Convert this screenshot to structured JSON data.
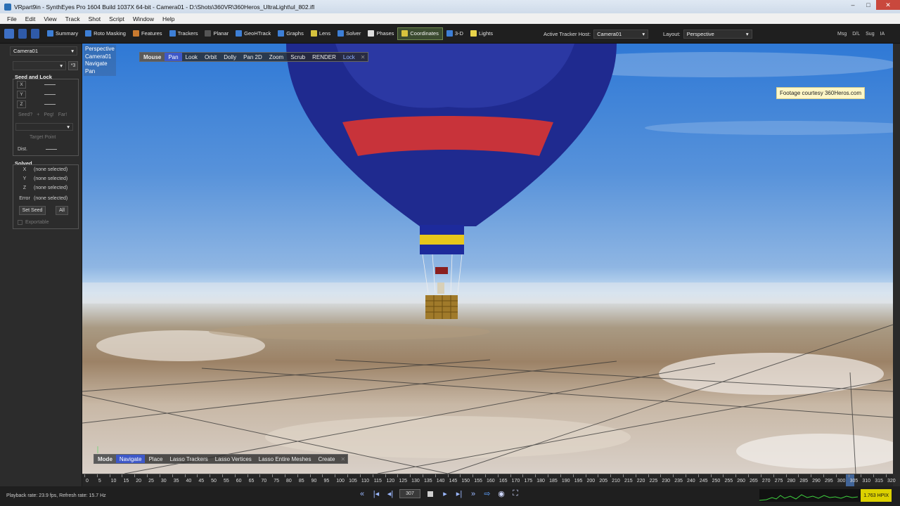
{
  "window": {
    "title": "VRpart9in - SynthEyes Pro 1604 Build 1037X 64-bit - Camera01 - D:\\Shots\\360VR\\360Heros_UltraLight\\ul_802.ifl",
    "controls": [
      "–",
      "□",
      "✕"
    ]
  },
  "menu": [
    "File",
    "Edit",
    "View",
    "Track",
    "Shot",
    "Script",
    "Window",
    "Help"
  ],
  "toolbar": {
    "buttons": [
      {
        "label": "Summary",
        "icon": "summary-icon",
        "color": "#3d7fd6"
      },
      {
        "label": "Roto Masking",
        "icon": "roto-icon",
        "color": "#3d7fd6"
      },
      {
        "label": "Features",
        "icon": "features-icon",
        "color": "#c97a2f"
      },
      {
        "label": "Trackers",
        "icon": "trackers-icon",
        "color": "#3d7fd6"
      },
      {
        "label": "Planar",
        "icon": "planar-icon",
        "color": "#555555"
      },
      {
        "label": "GeoHTrack",
        "icon": "geoh-icon",
        "color": "#3d7fd6"
      },
      {
        "label": "Graphs",
        "icon": "graphs-icon",
        "color": "#3d7fd6"
      },
      {
        "label": "Lens",
        "icon": "lens-icon",
        "color": "#d6c23d"
      },
      {
        "label": "Solver",
        "icon": "solver-icon",
        "color": "#3d7fd6"
      },
      {
        "label": "Phases",
        "icon": "phases-icon",
        "color": "#dddddd"
      },
      {
        "label": "Coordinates",
        "icon": "coordinates-icon",
        "color": "#d6c23d",
        "active": true
      },
      {
        "label": "3-D",
        "icon": "3d-icon",
        "color": "#3d7fd6"
      },
      {
        "label": "Lights",
        "icon": "lights-icon",
        "color": "#e8d34a"
      }
    ],
    "active_tracker_host_label": "Active Tracker Host:",
    "active_tracker_host_value": "Camera01",
    "layout_label": "Layout:",
    "layout_value": "Perspective",
    "right_buttons": [
      "Msg",
      "D/L",
      "Sug",
      "IA"
    ]
  },
  "left_panel": {
    "camera_select": "Camera01",
    "secondary_select": "",
    "seed_btn": "*3",
    "seed_lock_title": "Seed and Lock",
    "axes": [
      "X",
      "Y",
      "Z"
    ],
    "seed_buttons": [
      "Seed?",
      "+",
      "Peg!",
      "Far!"
    ],
    "target_point": "Target Point",
    "dist_label": "Dist.",
    "solved_title": "Solved",
    "solved_rows": [
      {
        "axis": "X",
        "value": "(none selected)"
      },
      {
        "axis": "Y",
        "value": "(none selected)"
      },
      {
        "axis": "Z",
        "value": "(none selected)"
      },
      {
        "axis": "Error",
        "value": "(none selected)"
      }
    ],
    "set_seed": "Set Seed",
    "all": "All",
    "exportable": "Exportable"
  },
  "viewport": {
    "info": [
      "Perspective",
      "Camera01",
      "Navigate",
      "Pan"
    ],
    "top_toolbar": {
      "mode": "Mouse",
      "items": [
        "Pan",
        "Look",
        "Orbit",
        "Dolly",
        "Pan 2D",
        "Zoom",
        "Scrub",
        "RENDER",
        "Lock"
      ],
      "selected": "Pan",
      "close": "✕"
    },
    "bottom_toolbar": {
      "mode": "Mode",
      "items": [
        "Navigate",
        "Place",
        "Lasso Trackers",
        "Lasso Vertices",
        "Lasso Entire Meshes",
        "Create"
      ],
      "selected": "Navigate",
      "close": "✕"
    },
    "courtesy": "Footage courtesy 360Heros.com",
    "colors": {
      "balloon_blue": "#1f2a8f",
      "balloon_red": "#c8333a",
      "basket": "#a07a2a"
    }
  },
  "timebar": {
    "ticks": [
      "0",
      "5",
      "10",
      "15",
      "20",
      "25",
      "30",
      "35",
      "40",
      "45",
      "50",
      "55",
      "60",
      "65",
      "70",
      "75",
      "80",
      "85",
      "90",
      "95",
      "100",
      "105",
      "110",
      "115",
      "120",
      "125",
      "130",
      "135",
      "140",
      "145",
      "150",
      "155",
      "160",
      "165",
      "170",
      "175",
      "180",
      "185",
      "190",
      "195",
      "200",
      "205",
      "210",
      "215",
      "220",
      "225",
      "230",
      "235",
      "240",
      "245",
      "250",
      "255",
      "260",
      "265",
      "270",
      "275",
      "280",
      "285",
      "290",
      "295",
      "300",
      "305",
      "310",
      "315",
      "320"
    ],
    "current_frame": "307"
  },
  "status": {
    "text": "Playback rate: 23.9 fps, Refresh rate: 15.7 Hz",
    "perf_value": "1.763 HPIX"
  }
}
